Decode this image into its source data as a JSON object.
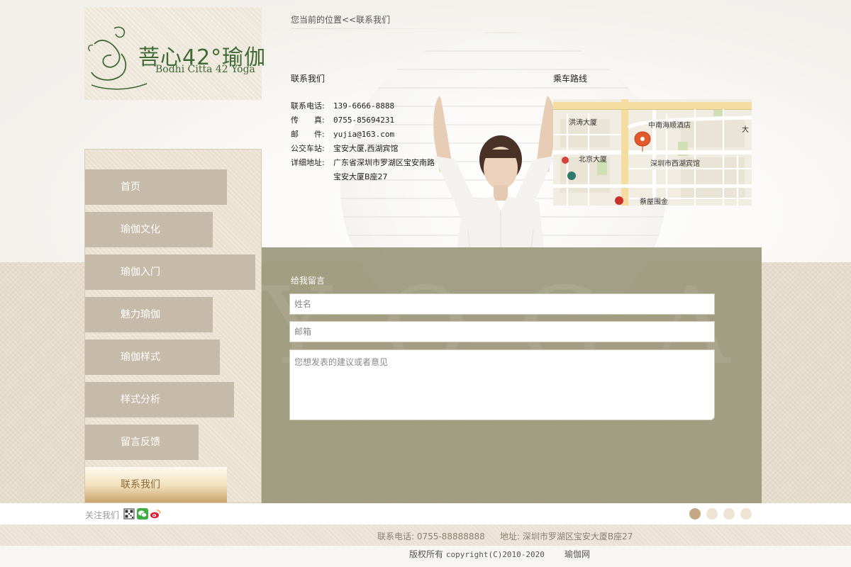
{
  "logo": {
    "cn": "菩心42°瑜伽",
    "en": "Bodhi Citta 42  Yoga"
  },
  "breadcrumb": "您当前的位置<<联系我们",
  "contact": {
    "title": "联系我们",
    "route_title": "乘车路线",
    "rows": [
      {
        "label": "联系电话:",
        "value": "139-6666-8888"
      },
      {
        "label": "传　　真:",
        "value": "0755-85694231"
      },
      {
        "label": "邮　　件:",
        "value": "yujia@163.com"
      },
      {
        "label": "公交车站:",
        "value": "宝安大厦,西湖宾馆"
      },
      {
        "label": "详细地址:",
        "value": "广东省深圳市罗湖区宝安南路"
      },
      {
        "label": "",
        "value": "宝安大厦B座27"
      }
    ]
  },
  "map": {
    "labels": [
      "洪涛大厦",
      "中南海顺酒店",
      "大",
      "北京大厦",
      "深圳市西湖宾馆",
      "蔡屋围金"
    ]
  },
  "nav": {
    "items": [
      {
        "label": "首页"
      },
      {
        "label": "瑜伽文化"
      },
      {
        "label": "瑜伽入门"
      },
      {
        "label": "魅力瑜伽"
      },
      {
        "label": "瑜伽样式"
      },
      {
        "label": "样式分析"
      },
      {
        "label": "留言反馈"
      },
      {
        "label": "联系我们"
      }
    ],
    "active_index": 7
  },
  "message": {
    "title": "给我留言",
    "watermark": "YOGA",
    "name_placeholder": "姓名",
    "email_placeholder": "邮箱",
    "comment_placeholder": "您想发表的建议或者意见"
  },
  "footer": {
    "follow": "关注我们",
    "phone": "联系电话: 0755-88888888",
    "address": "地址: 深圳市罗湖区宝安大厦B座27",
    "copyright_prefix": "版权所有",
    "copyright": "copyright(C)2010-2020",
    "site": "瑜伽网",
    "slide_count": 4,
    "slide_active": 0
  },
  "colors": {
    "accent_green": "#3f6a35",
    "nav_item": "#c6bba8",
    "panel": "#9b997c",
    "map_pin": "#e25a2b"
  }
}
